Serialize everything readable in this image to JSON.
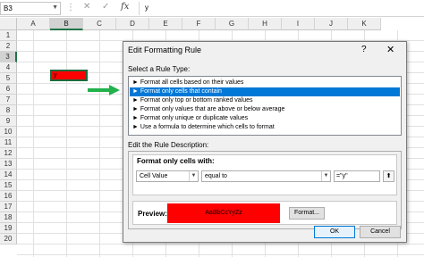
{
  "formula_bar": {
    "name_box": "B3",
    "separator_icon": "vertical-dots",
    "cancel_icon": "✕",
    "enter_icon": "✓",
    "fx_label": "fx",
    "cell_value": "y"
  },
  "sheet": {
    "columns": [
      "A",
      "B",
      "C",
      "D",
      "E",
      "F",
      "G",
      "H",
      "I",
      "J",
      "K"
    ],
    "selected_column": "B",
    "rows": [
      "1",
      "2",
      "3",
      "4",
      "5",
      "6",
      "7",
      "8",
      "9",
      "10",
      "11",
      "12",
      "13",
      "14",
      "15",
      "16",
      "17",
      "18",
      "19",
      "20"
    ],
    "selected_row": "3",
    "active_cell_text": "y",
    "active_cell_fill": "#ff0000"
  },
  "annotation": {
    "arrow_color": "#22b14c"
  },
  "dialog": {
    "title": "Edit Formatting Rule",
    "help_label": "?",
    "close_label": "✕",
    "select_type_label": "Select a Rule Type:",
    "rule_types": [
      "► Format all cells based on their values",
      "► Format only cells that contain",
      "► Format only top or bottom ranked values",
      "► Format only values that are above or below average",
      "► Format only unique or duplicate values",
      "► Use a formula to determine which cells to format"
    ],
    "selected_rule_index": 1,
    "description_label": "Edit the Rule Description:",
    "format_only_label": "Format only cells with:",
    "condition_type": "Cell Value",
    "operator": "equal to",
    "value": "=\"y\"",
    "preview_label": "Preview:",
    "preview_text": "AaBbCcYyZz",
    "preview_fill": "#ff0000",
    "format_button": "Format...",
    "ok_button": "OK",
    "cancel_button": "Cancel"
  }
}
